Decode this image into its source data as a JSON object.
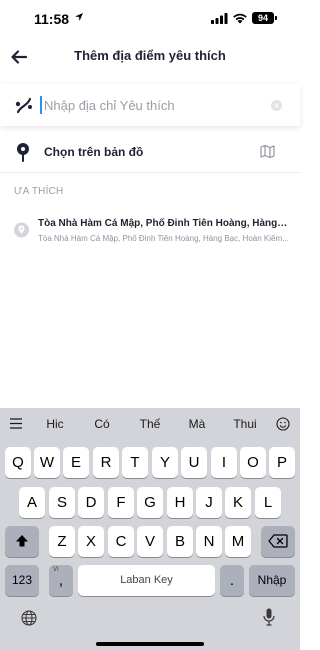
{
  "status_bar": {
    "time": "11:58",
    "battery": "94"
  },
  "header": {
    "title": "Thêm địa điểm yêu thích"
  },
  "search": {
    "placeholder": "Nhập địa chỉ Yêu thích",
    "value": ""
  },
  "map_pick": {
    "label": "Chọn trên bản đồ"
  },
  "favorites": {
    "section_label": "ƯA THÍCH",
    "items": [
      {
        "title": "Tòa Nhà Hàm Cá Mập, Phố Đinh Tiên Hoàng, Hàng Bạc...",
        "subtitle": "Tòa Nhà Hàm Cá Mập, Phố Đinh Tiên Hoàng, Hàng Bạc, Hoàn Kiếm..."
      }
    ]
  },
  "keyboard": {
    "suggestions": [
      "Hic",
      "Có",
      "Thế",
      "Mà",
      "Thui"
    ],
    "row1": [
      "Q",
      "W",
      "E",
      "R",
      "T",
      "Y",
      "U",
      "I",
      "O",
      "P"
    ],
    "row2": [
      "A",
      "S",
      "D",
      "F",
      "G",
      "H",
      "J",
      "K",
      "L"
    ],
    "row3": [
      "Z",
      "X",
      "C",
      "V",
      "B",
      "N",
      "M"
    ],
    "numbers_label": "123",
    "comma_label": ",",
    "comma_hint": "VI",
    "space_label": "Laban Key",
    "period_label": ".",
    "return_label": "Nhập"
  }
}
